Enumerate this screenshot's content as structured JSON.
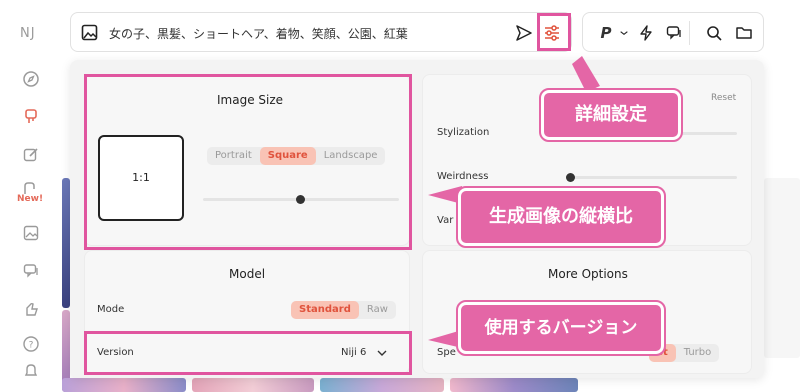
{
  "app": {
    "logo": "NJ",
    "new_badge": "New!",
    "rail_icons": [
      "compass-icon",
      "brush-icon",
      "edit-icon",
      "mask-icon",
      "image-icon",
      "chat-icon",
      "thumbs-up-icon",
      "help-icon",
      "bell-icon"
    ]
  },
  "prompt_bar": {
    "text": "女の子、黒髪、ショートヘア、着物、笑顔、公園、紅葉",
    "icons": [
      "image-icon",
      "send-icon",
      "settings-sliders-icon"
    ]
  },
  "toolbar": {
    "personalize": "P",
    "icons": [
      "chevron-down-icon",
      "lightning-icon",
      "chat-icon",
      "search-icon",
      "folder-icon"
    ]
  },
  "image_size": {
    "title": "Image Size",
    "ratio": "1:1",
    "orientation_options": [
      "Portrait",
      "Square",
      "Landscape"
    ],
    "orientation_selected": "Square",
    "slider_value": 0.5
  },
  "aesthetics": {
    "reset": "Reset",
    "stylization": "Stylization",
    "weirdness": "Weirdness",
    "variety_partial": "Var",
    "weirdness_value": 0
  },
  "model": {
    "title": "Model",
    "mode_label": "Mode",
    "mode_options": [
      "Standard",
      "Raw"
    ],
    "mode_selected": "Standard",
    "version_label": "Version",
    "version_value": "Niji 6"
  },
  "more_options": {
    "title": "More Options",
    "speed_partial": "Spe",
    "speed_options": [
      "st",
      "Turbo"
    ],
    "speed_selected": "st"
  },
  "annotations": {
    "detailed_settings": "詳細設定",
    "aspect_ratio": "生成画像の縦横比",
    "version_used": "使用するバージョン"
  },
  "colors": {
    "highlight": "#e0559f",
    "accent": "#e0533d"
  }
}
